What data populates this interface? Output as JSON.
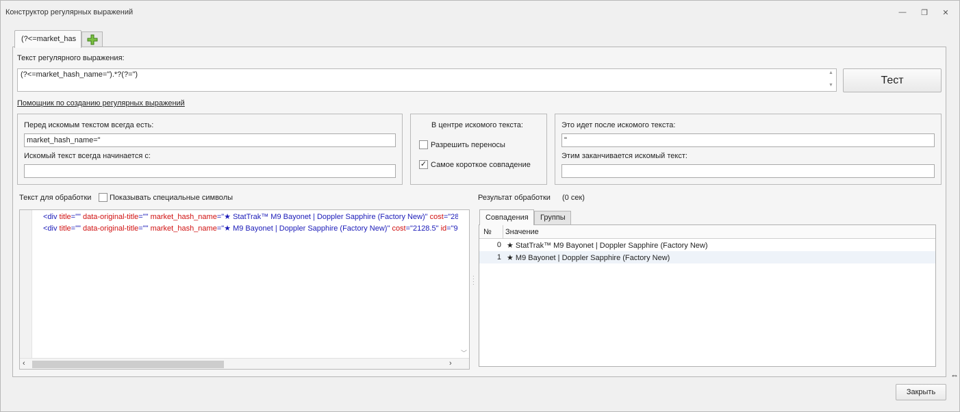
{
  "window": {
    "title": "Конструктор регулярных выражений",
    "minimize_glyph": "—",
    "restore_glyph": "❐",
    "close_glyph": "✕"
  },
  "tabs": {
    "active_label": "(?<=market_has",
    "add_icon": "plus-icon"
  },
  "regex": {
    "label": "Текст регулярного выражения:",
    "value": "(?<=market_hash_name=\").*?(?=\")",
    "test_button": "Тест"
  },
  "helper": {
    "link": "Помощник по созданию регулярных выражений",
    "before": {
      "label": "Перед искомым текстом всегда есть:",
      "value": "market_hash_name=\"",
      "starts_label": "Искомый текст всегда начинается с:",
      "starts_value": ""
    },
    "center": {
      "label": "В центре искомого текста:",
      "allow_newlines": "Разрешить переносы",
      "allow_newlines_checked": false,
      "shortest_match": "Самое короткое совпадение",
      "shortest_match_checked": true
    },
    "after": {
      "label": "Это идет после искомого текста:",
      "value": "\"",
      "ends_label": "Этим заканчивается искомый текст:",
      "ends_value": ""
    }
  },
  "input_text": {
    "label": "Текст для обработки",
    "show_special_label": "Показывать специальные символы",
    "show_special_checked": false,
    "lines": [
      [
        {
          "t": "<div ",
          "c": "tag"
        },
        {
          "t": "title",
          "c": "attr"
        },
        {
          "t": "=\"\" ",
          "c": "val"
        },
        {
          "t": "data-original-title",
          "c": "attr"
        },
        {
          "t": "=\"\" ",
          "c": "val"
        },
        {
          "t": "market_hash_name",
          "c": "attr"
        },
        {
          "t": "=\"★ StatTrak™ M9 Bayonet | Doppler Sapphire (Factory New)\" ",
          "c": "val"
        },
        {
          "t": "cost",
          "c": "attr"
        },
        {
          "t": "=\"28",
          "c": "val"
        }
      ],
      [
        {
          "t": "<div ",
          "c": "tag"
        },
        {
          "t": "title",
          "c": "attr"
        },
        {
          "t": "=\"\" ",
          "c": "val"
        },
        {
          "t": "data-original-title",
          "c": "attr"
        },
        {
          "t": "=\"\" ",
          "c": "val"
        },
        {
          "t": "market_hash_name",
          "c": "attr"
        },
        {
          "t": "=\"★ M9 Bayonet | Doppler Sapphire (Factory New)\" ",
          "c": "val"
        },
        {
          "t": "cost",
          "c": "attr"
        },
        {
          "t": "=\"2128.5\" ",
          "c": "val"
        },
        {
          "t": "id",
          "c": "attr"
        },
        {
          "t": "=\"9",
          "c": "val"
        }
      ]
    ]
  },
  "result": {
    "label": "Результат обработки",
    "time": "(0 сек)",
    "tab_matches": "Совпадения",
    "tab_groups": "Группы",
    "col_num": "№",
    "col_value": "Значение",
    "rows": [
      {
        "num": "0",
        "value": "★ StatTrak™ M9 Bayonet | Doppler Sapphire (Factory New)"
      },
      {
        "num": "1",
        "value": "★ M9 Bayonet | Doppler Sapphire (Factory New)"
      }
    ]
  },
  "close_button": "Закрыть"
}
